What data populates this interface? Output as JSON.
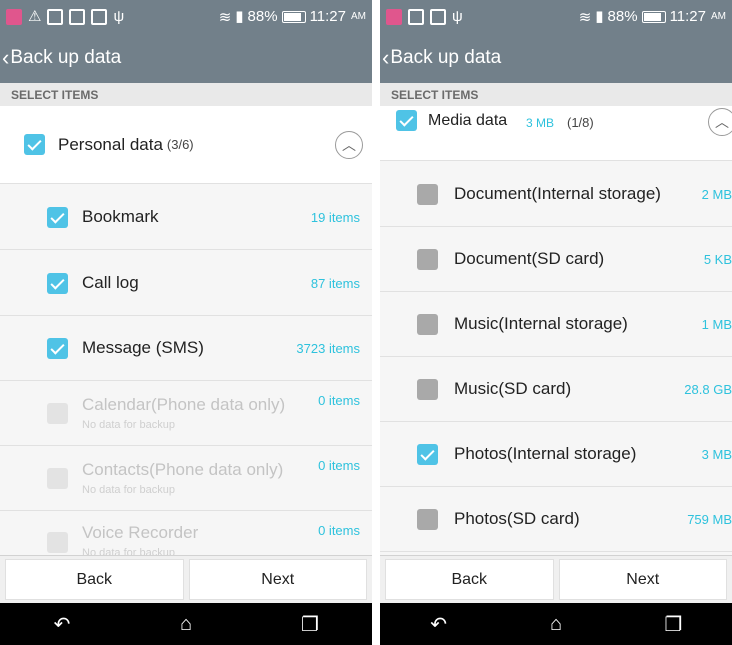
{
  "left": {
    "status": {
      "battery": "88%",
      "time": "11:27",
      "ampm": "AM"
    },
    "title": "Back up data",
    "section_header": "SELECT ITEMS",
    "group": {
      "label": "Personal data",
      "count": "(3/6)"
    },
    "items": [
      {
        "label": "Bookmark",
        "count": "19 items",
        "checked": true,
        "disabled": false,
        "sub": ""
      },
      {
        "label": "Call log",
        "count": "87 items",
        "checked": true,
        "disabled": false,
        "sub": ""
      },
      {
        "label": "Message (SMS)",
        "count": "3723 items",
        "checked": true,
        "disabled": false,
        "sub": ""
      },
      {
        "label": "Calendar(Phone data only)",
        "count": "0 items",
        "checked": false,
        "disabled": true,
        "sub": "No data for backup"
      },
      {
        "label": "Contacts(Phone data only)",
        "count": "0 items",
        "checked": false,
        "disabled": true,
        "sub": "No data for backup"
      },
      {
        "label": "Voice Recorder",
        "count": "0 items",
        "checked": false,
        "disabled": true,
        "sub": "No data for backup"
      }
    ],
    "footer": {
      "back": "Back",
      "next": "Next"
    }
  },
  "right": {
    "status": {
      "battery": "88%",
      "time": "11:27",
      "ampm": "AM"
    },
    "title": "Back up data",
    "section_header": "SELECT ITEMS",
    "group": {
      "label": "Media data",
      "size": "3 MB",
      "count": "(1/8)"
    },
    "items": [
      {
        "label": "Document(Internal storage)",
        "count": "2 MB",
        "checked": false
      },
      {
        "label": "Document(SD card)",
        "count": "5 KB",
        "checked": false
      },
      {
        "label": "Music(Internal storage)",
        "count": "1 MB",
        "checked": false
      },
      {
        "label": "Music(SD card)",
        "count": "28.8 GB",
        "checked": false
      },
      {
        "label": "Photos(Internal storage)",
        "count": "3 MB",
        "checked": true
      },
      {
        "label": "Photos(SD card)",
        "count": "759 MB",
        "checked": false
      }
    ],
    "footer": {
      "back": "Back",
      "next": "Next"
    }
  },
  "colors": {
    "bar": "#72808a",
    "accent": "#2ec2dd",
    "checkbox_on": "#4fc3e6"
  }
}
